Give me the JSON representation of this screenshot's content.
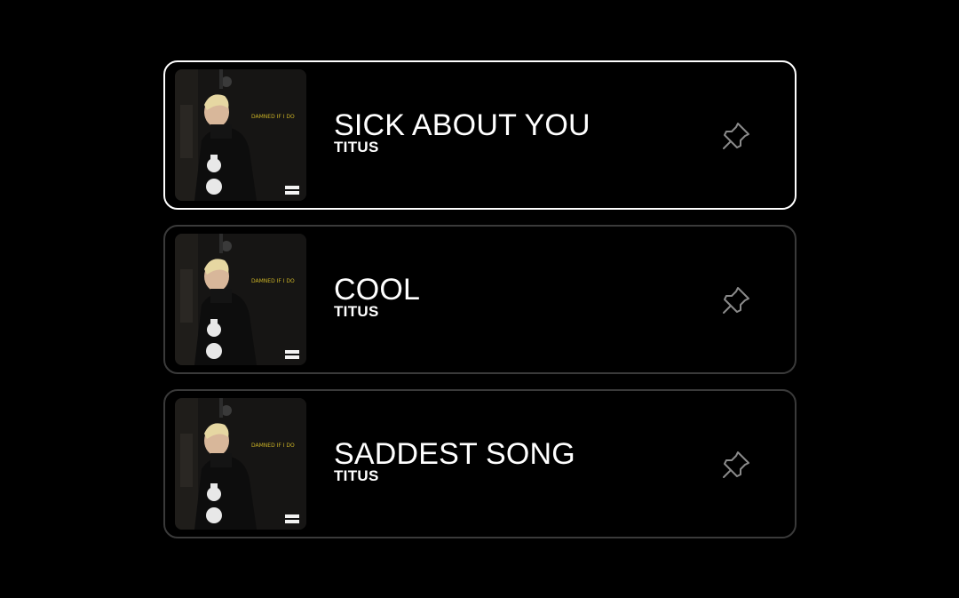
{
  "tracks": [
    {
      "title": "SICK ABOUT YOU",
      "artist": "TITUS",
      "selected": true,
      "art_icon": "album-cover",
      "pin_icon": "pin-icon"
    },
    {
      "title": "COOL",
      "artist": "TITUS",
      "selected": false,
      "art_icon": "album-cover",
      "pin_icon": "pin-icon"
    },
    {
      "title": "SADDEST SONG",
      "artist": "TITUS",
      "selected": false,
      "art_icon": "album-cover",
      "pin_icon": "pin-icon"
    }
  ],
  "album_art": {
    "cover_text": "DAMNED IF I DO",
    "advisory_label": "PARENTAL ADVISORY"
  },
  "colors": {
    "background": "#000000",
    "card_border": "#3a3a3a",
    "card_border_selected": "#ffffff",
    "text": "#ffffff",
    "pin": "#8a8a8a",
    "cover_text": "#c9b126"
  }
}
